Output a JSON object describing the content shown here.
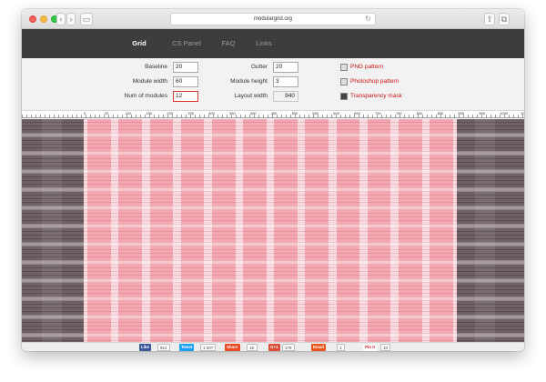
{
  "browser": {
    "url": "modulargrid.org"
  },
  "nav": {
    "items": [
      "Grid",
      "CS Panel",
      "FAQ",
      "Links"
    ],
    "active": "Grid"
  },
  "settings": {
    "baseline": {
      "label": "Baseline",
      "value": "20"
    },
    "module_width": {
      "label": "Module width",
      "value": "60"
    },
    "num_modules": {
      "label": "Num of modules",
      "value": "12"
    },
    "gutter": {
      "label": "Gutter",
      "value": "20"
    },
    "module_height": {
      "label": "Module height",
      "value": "3"
    },
    "layout_width": {
      "label": "Layout width",
      "value": "940"
    }
  },
  "downloads": {
    "png": "PNG pattern",
    "psd": "Photoshop pattern",
    "mask": "Transparency mask"
  },
  "ruler": {
    "labels": [
      "0",
      "20",
      "100",
      "150",
      "200",
      "250",
      "300",
      "350",
      "400",
      "450",
      "500",
      "550",
      "600",
      "650",
      "700",
      "750",
      "800",
      "850",
      "900",
      "950",
      "1000",
      "1050"
    ]
  },
  "colors": {
    "module": "#f5a7b1",
    "gutter": "#fadadf",
    "outside": "#6e6266",
    "nav_bg": "#3d3d3d",
    "link": "#cc1111"
  },
  "share": {
    "facebook": {
      "label": "Like",
      "count": "914"
    },
    "twitter": {
      "label": "Tweet",
      "count": "1 207"
    },
    "stumble": {
      "label": "Share",
      "count": "1K"
    },
    "gplus": {
      "label": "G+1",
      "count": "179"
    },
    "email": {
      "label": "Email",
      "count": "1"
    },
    "pinterest": {
      "label": "Pin it",
      "count": "10"
    }
  }
}
